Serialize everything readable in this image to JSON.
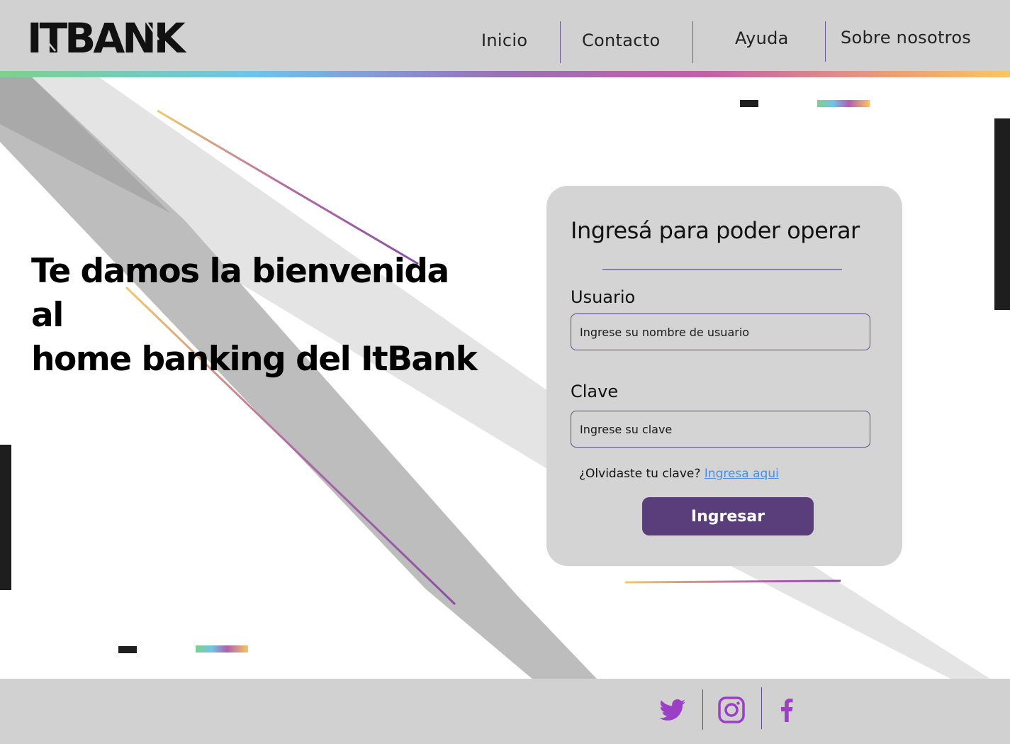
{
  "header": {
    "logo_text": "ITBANK",
    "nav": [
      {
        "label": "Inicio"
      },
      {
        "label": "Contacto"
      },
      {
        "label": "Ayuda"
      },
      {
        "label": "Sobre nosotros"
      }
    ]
  },
  "hero": {
    "title_line1": "Te damos la bienvenida al",
    "title_line2": "home banking del ItBank"
  },
  "login": {
    "title": "Ingresá para poder operar",
    "user_label": "Usuario",
    "user_placeholder": "Ingrese su nombre de usuario",
    "user_value": "",
    "password_label": "Clave",
    "password_placeholder": "Ingrese su clave",
    "password_value": "",
    "forgot_text": "¿Olvidaste tu clave?",
    "forgot_link": "Ingresa aqui",
    "submit_label": "Ingresar"
  },
  "footer": {
    "social": [
      {
        "icon": "twitter-icon"
      },
      {
        "icon": "instagram-icon"
      },
      {
        "icon": "facebook-icon"
      }
    ]
  },
  "colors": {
    "header_bg": "#d1d1d1",
    "accent_purple": "#5a3e7c",
    "social_purple": "#9b3fc4",
    "link_blue": "#4a8fe0",
    "card_bg": "#d4d4d4"
  }
}
